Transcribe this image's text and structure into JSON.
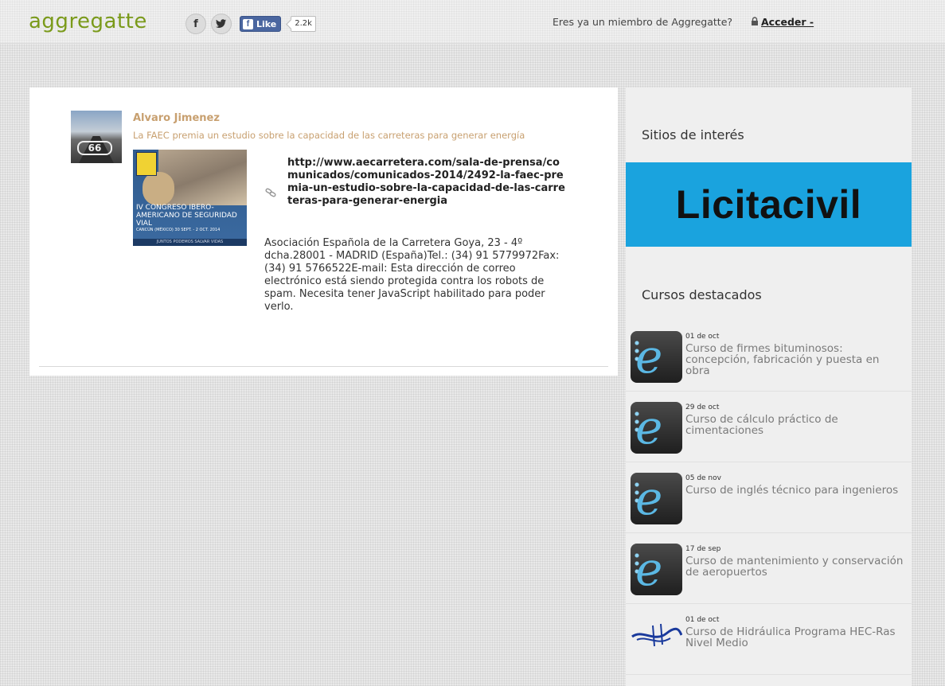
{
  "header": {
    "logo": "aggregatte",
    "facebook_icon": "f",
    "twitter_icon": "twitter-bird",
    "like_label": "Like",
    "like_count": "2.2k",
    "member_text": "Eres ya un miembro de Aggregatte?",
    "login_label": "Acceder -"
  },
  "post": {
    "author": "Alvaro Jimenez",
    "headline": "La FAEC premia un estudio sobre la capacidad de las carreteras para generar energía",
    "thumb_title": "IV CONGRESO IBERO-AMERICANO DE SEGURIDAD VIAL",
    "thumb_sub": "CANCÚN (MÉXICO) 30 SEPT. - 2 OCT. 2014",
    "thumb_footer": "JUNTOS PODEMOS SALVAR VIDAS",
    "link_url": "http://www.aecarretera.com/sala-de-prensa/comunicados/comunicados-2014/2492-la-faec-premia-un-estudio-sobre-la-capacidad-de-las-carreteras-para-generar-energia",
    "description": "Asociación Española de la Carretera Goya, 23 - 4º dcha.28001 - MADRID (España)Tel.: (34) 91 5779972Fax: (34) 91 5766522E-mail: Esta dirección de correo electrónico está siendo protegida contra los robots de spam. Necesita tener JavaScript habilitado para poder verlo."
  },
  "sidebar": {
    "sites_title": "Sitios de interés",
    "banner_text": "Licitacivil",
    "courses_title": "Cursos destacados",
    "courses": [
      {
        "date": "01 de oct",
        "title": "Curso de firmes bituminosos: concepción, fabricación y puesta en obra"
      },
      {
        "date": "29 de oct",
        "title": "Curso de cálculo práctico de cimentaciones"
      },
      {
        "date": "05 de nov",
        "title": "Curso de inglés técnico para ingenieros"
      },
      {
        "date": "17 de sep",
        "title": "Curso de mantenimiento y conservación de aeropuertos"
      },
      {
        "date": "01 de oct",
        "title": "Curso de Hidráulica Programa HEC-Ras Nivel Medio"
      }
    ]
  }
}
